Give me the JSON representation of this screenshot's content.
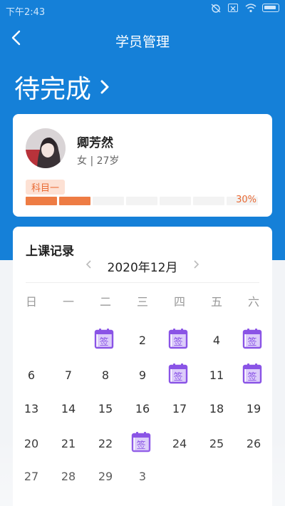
{
  "status_bar": {
    "time": "下午2:43"
  },
  "nav": {
    "title": "学员管理"
  },
  "header": {
    "pending_label": "待完成"
  },
  "student": {
    "name": "卿芳然",
    "info": "女 | 27岁",
    "subject": "科目一",
    "progress_percent": "30%",
    "progress_fraction": 0.3,
    "segments_total": 7,
    "segments_filled": 2
  },
  "records": {
    "title": "上课记录",
    "month": "2020年12月",
    "prev_icon": "chevron-left-icon",
    "next_icon": "chevron-right-icon",
    "weekdays": [
      "日",
      "一",
      "二",
      "三",
      "四",
      "五",
      "六"
    ],
    "sign_label": "签",
    "sign_color": "#8a54e6",
    "rows": [
      [
        "",
        "",
        "签",
        "2",
        "签",
        "4",
        "签"
      ],
      [
        "6",
        "7",
        "8",
        "9",
        "签",
        "11",
        "签"
      ],
      [
        "13",
        "14",
        "15",
        "16",
        "17",
        "18",
        "19"
      ],
      [
        "20",
        "21",
        "22",
        "签",
        "24",
        "25",
        "26"
      ],
      [
        "27",
        "28",
        "29",
        "3",
        "",
        "",
        ""
      ]
    ]
  },
  "colors": {
    "primary_blue": "#1580d8",
    "accent_orange": "#ee7c44"
  }
}
